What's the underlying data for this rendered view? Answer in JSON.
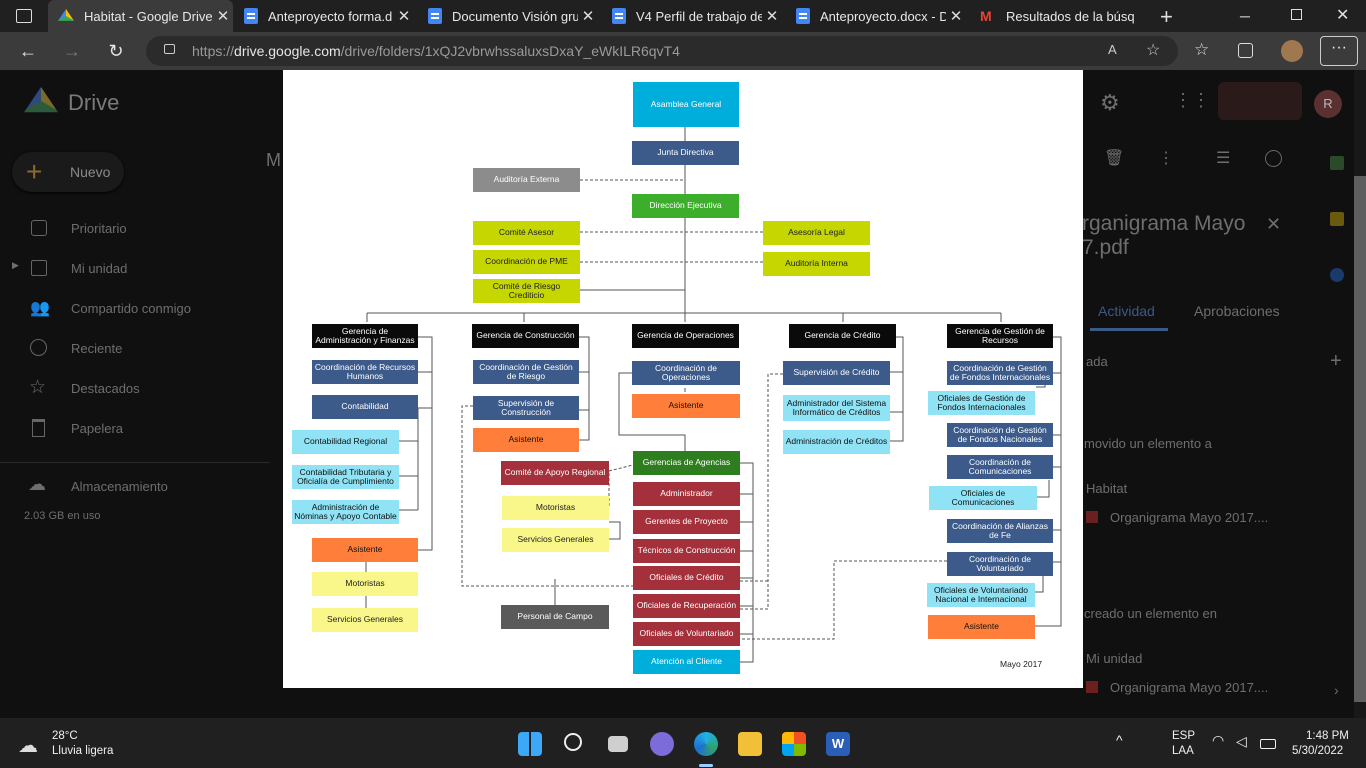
{
  "tabs": [
    {
      "title": "Habitat - Google Drive",
      "icon": "drive-icon",
      "active": true
    },
    {
      "title": "Anteproyecto forma.d",
      "icon": "docs-icon"
    },
    {
      "title": "Documento Visión gru",
      "icon": "docs-icon"
    },
    {
      "title": "V4 Perfil de trabajo de",
      "icon": "docs-icon"
    },
    {
      "title": "Anteproyecto.docx - D",
      "icon": "docs-icon"
    },
    {
      "title": "Resultados de la búsq",
      "icon": "gmail-icon"
    }
  ],
  "address": {
    "prefix": "https://",
    "host": "drive.google.com",
    "path": "/drive/folders/1xQJ2vbrwhssaluxsDxaY_eWkILR6qvT4"
  },
  "drive": {
    "logo": "Drive",
    "new_button": "Nuevo",
    "nav": [
      "Prioritario",
      "Mi unidad",
      "Compartido conmigo",
      "Reciente",
      "Destacados",
      "Papelera"
    ],
    "storage_label": "Almacenamiento",
    "storage_used": "2.03 GB en uso",
    "header_letter": "M",
    "panel": {
      "title_line1": "rganigrama Mayo",
      "title_line2": "7.pdf",
      "tab_activity": "Actividad",
      "tab_approvals": "Aprobaciones",
      "item1": "ada",
      "item2": "movido un elemento a",
      "folder1": "Habitat",
      "file1": "Organigrama Mayo 2017....",
      "item3": "creado un elemento en",
      "folder2": "Mi unidad",
      "file2": "Organigrama Mayo 2017...."
    },
    "avatar_letter": "R"
  },
  "org": {
    "asamblea": "Asamblea General",
    "junta": "Junta Directiva",
    "auditoria_externa": "Auditoría Externa",
    "direccion": "Dirección Ejecutiva",
    "comite_asesor": "Comité Asesor",
    "coord_pme": "Coordinación de PME",
    "comite_riesgo": "Comité de Riesgo Crediticio",
    "asesoria_legal": "Asesoría Legal",
    "auditoria_interna": "Auditoría Interna",
    "g_admin": "Gerencia de Administración y Finanzas",
    "g_construccion": "Gerencia de Construcción",
    "g_operaciones": "Gerencia de Operaciones",
    "g_credito": "Gerencia de Crédito",
    "g_recursos": "Gerencia de Gestión de Recursos",
    "admin": {
      "coord_rrhh": "Coordinación de Recursos Humanos",
      "contabilidad": "Contabilidad",
      "contabilidad_regional": "Contabilidad Regional",
      "contabilidad_tributaria": "Contabilidad Tributaria y Oficialía de Cumplimiento",
      "nominas": "Administración de Nóminas y Apoyo Contable",
      "asistente": "Asistente",
      "motoristas": "Motoristas",
      "servicios": "Servicios Generales"
    },
    "construccion": {
      "coord_riesgo": "Coordinación de Gestión de Riesgo",
      "supervision": "Supervisión de Construcción",
      "asistente": "Asistente",
      "comite_apoyo": "Comité de Apoyo Regional",
      "motoristas": "Motoristas",
      "servicios": "Servicios Generales",
      "personal_campo": "Personal de Campo"
    },
    "operaciones": {
      "coord_op": "Coordinación de Operaciones",
      "asistente": "Asistente",
      "gerencias_agencias": "Gerencias de Agencias",
      "administrador": "Administrador",
      "gerentes_proyecto": "Gerentes de Proyecto",
      "tecnicos": "Técnicos de Construcción",
      "oficiales_credito": "Oficiales de Crédito",
      "oficiales_recuperacion": "Oficiales de Recuperación",
      "oficiales_voluntariado": "Oficiales de Voluntariado",
      "atencion": "Atención al Cliente"
    },
    "credito": {
      "supervision": "Supervisión de Crédito",
      "admin_sistema": "Administrador del Sistema Informático de Créditos",
      "admin_creditos": "Administración de Créditos"
    },
    "recursos": {
      "coord_intl": "Coordinación de Gestión de Fondos Internacionales",
      "of_intl": "Oficiales de Gestión de Fondos Internacionales",
      "coord_nac": "Coordinación de Gestión de Fondos Nacionales",
      "coord_com": "Coordinación de Comunicaciones",
      "of_com": "Oficiales de Comunicaciones",
      "coord_alianzas": "Coordinación de Alianzas de Fe",
      "coord_vol": "Coordinación de Voluntariado",
      "of_vol": "Oficiales de Voluntariado Nacional e Internacional",
      "asistente": "Asistente"
    },
    "date": "Mayo 2017"
  },
  "taskbar": {
    "weather_temp": "28°C",
    "weather_desc": "Lluvia ligera",
    "lang1": "ESP",
    "lang2": "LAA",
    "time": "1:48 PM",
    "date": "5/30/2022"
  }
}
